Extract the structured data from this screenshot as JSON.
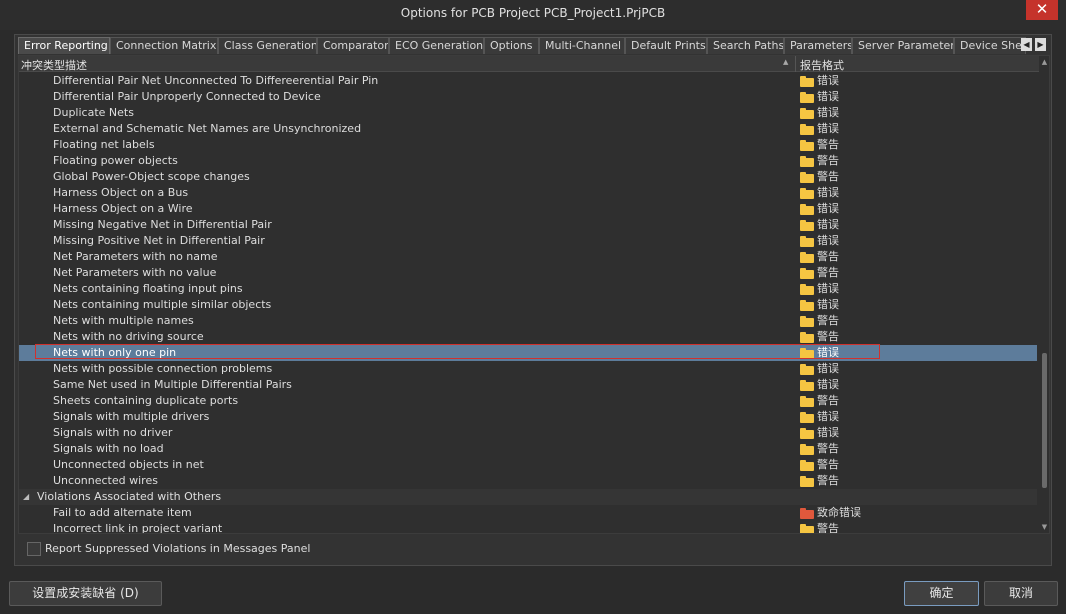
{
  "window": {
    "title": "Options for PCB Project PCB_Project1.PrjPCB",
    "close_glyph": "✕"
  },
  "tabs": [
    {
      "label": "Error Reporting",
      "active": true
    },
    {
      "label": "Connection Matrix"
    },
    {
      "label": "Class Generation"
    },
    {
      "label": "Comparator"
    },
    {
      "label": "ECO Generation"
    },
    {
      "label": "Options"
    },
    {
      "label": "Multi-Channel"
    },
    {
      "label": "Default Prints"
    },
    {
      "label": "Search Paths"
    },
    {
      "label": "Parameters"
    },
    {
      "label": "Server Parameters"
    },
    {
      "label": "Device Sheets"
    }
  ],
  "tab_scroll": {
    "left_glyph": "◀",
    "right_glyph": "▶"
  },
  "table": {
    "col_description": "冲突类型描述",
    "col_format": "报告格式",
    "sort_glyph": "▲",
    "rows": [
      {
        "label": "Differential Pair Net Unconnected To Differeerential Pair Pin",
        "level": "错误",
        "color": "#f5c542"
      },
      {
        "label": "Differential Pair Unproperly Connected to Device",
        "level": "错误",
        "color": "#f5c542"
      },
      {
        "label": "Duplicate Nets",
        "level": "错误",
        "color": "#f5c542"
      },
      {
        "label": "External and Schematic Net Names are Unsynchronized",
        "level": "错误",
        "color": "#f5c542"
      },
      {
        "label": "Floating net labels",
        "level": "警告",
        "color": "#f5c542"
      },
      {
        "label": "Floating power objects",
        "level": "警告",
        "color": "#f5c542"
      },
      {
        "label": "Global Power-Object scope changes",
        "level": "警告",
        "color": "#f5c542"
      },
      {
        "label": "Harness Object on a Bus",
        "level": "错误",
        "color": "#f5c542"
      },
      {
        "label": "Harness Object on a Wire",
        "level": "错误",
        "color": "#f5c542"
      },
      {
        "label": "Missing Negative Net in Differential Pair",
        "level": "错误",
        "color": "#f5c542"
      },
      {
        "label": "Missing Positive Net in Differential Pair",
        "level": "错误",
        "color": "#f5c542"
      },
      {
        "label": "Net Parameters with no name",
        "level": "警告",
        "color": "#f5c542"
      },
      {
        "label": "Net Parameters with no value",
        "level": "警告",
        "color": "#f5c542"
      },
      {
        "label": "Nets containing floating input pins",
        "level": "错误",
        "color": "#f5c542"
      },
      {
        "label": "Nets containing multiple similar objects",
        "level": "错误",
        "color": "#f5c542"
      },
      {
        "label": "Nets with multiple names",
        "level": "警告",
        "color": "#f5c542"
      },
      {
        "label": "Nets with no driving source",
        "level": "警告",
        "color": "#f5c542"
      },
      {
        "label": "Nets with only one pin",
        "level": "错误",
        "color": "#f5c542",
        "selected": true
      },
      {
        "label": "Nets with possible connection problems",
        "level": "错误",
        "color": "#f5c542"
      },
      {
        "label": "Same Net used in Multiple Differential Pairs",
        "level": "错误",
        "color": "#f5c542"
      },
      {
        "label": "Sheets containing duplicate ports",
        "level": "警告",
        "color": "#f5c542"
      },
      {
        "label": "Signals with multiple drivers",
        "level": "错误",
        "color": "#f5c542"
      },
      {
        "label": "Signals with no driver",
        "level": "错误",
        "color": "#f5c542"
      },
      {
        "label": "Signals with no load",
        "level": "警告",
        "color": "#f5c542"
      },
      {
        "label": "Unconnected objects in net",
        "level": "警告",
        "color": "#f5c542"
      },
      {
        "label": "Unconnected wires",
        "level": "警告",
        "color": "#f5c542"
      },
      {
        "label": "Violations Associated with Others",
        "group": true,
        "arrow": "◢"
      },
      {
        "label": "Fail to add alternate item",
        "level": "致命错误",
        "color": "#e0583c"
      },
      {
        "label": "Incorrect link in project variant",
        "level": "警告",
        "color": "#f5c542"
      }
    ]
  },
  "scroll": {
    "up_glyph": "▲",
    "down_glyph": "▼"
  },
  "checkbox_label": "Report Suppressed Violations in Messages Panel",
  "buttons": {
    "defaults": "设置成安装缺省 (D)",
    "ok": "确定",
    "cancel": "取消"
  }
}
